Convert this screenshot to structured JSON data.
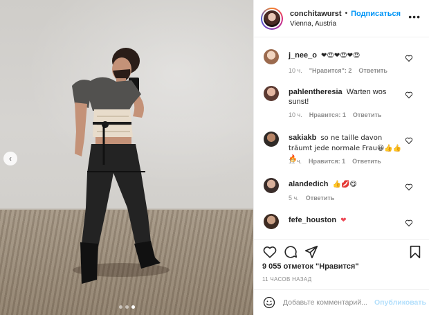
{
  "post": {
    "username": "conchitawurst",
    "follow_label": "Подписаться",
    "separator": "•",
    "location": "Vienna, Austria",
    "more_icon": "more-horizontal-icon",
    "carousel": {
      "slides": 3,
      "active_slide": 3
    }
  },
  "comments": [
    {
      "user": "j_nee_o",
      "text": "❤😍❤😍❤😍",
      "age": "10 ч.",
      "likes": "\"Нравится\": 2",
      "reply": "Ответить"
    },
    {
      "user": "pahlentheresia",
      "text": "Warten wos sunst!",
      "age": "10 ч.",
      "likes": "Нравится: 1",
      "reply": "Ответить"
    },
    {
      "user": "sakiakb",
      "text": "so ne taille davon träumt jede normale Frau😀👍👍🔥",
      "age": "11 ч.",
      "likes": "Нравится: 1",
      "reply": "Ответить"
    },
    {
      "user": "alandedich",
      "text": "👍💋😋",
      "age": "5 ч.",
      "likes": "",
      "reply": "Ответить"
    },
    {
      "user": "fefe_houston",
      "text": "❤",
      "age": "",
      "likes": "",
      "reply": ""
    }
  ],
  "footer": {
    "likes_text": "9 055 отметок \"Нравится\"",
    "time_ago": "11 ЧАСОВ НАЗАД",
    "comment_placeholder": "Добавьте комментарий...",
    "publish_label": "Опубликовать"
  },
  "colors": {
    "accent": "#0095f6",
    "publish_disabled": "#b2dffc",
    "muted": "#8e8e8e",
    "heart_red": "#ed4956"
  }
}
